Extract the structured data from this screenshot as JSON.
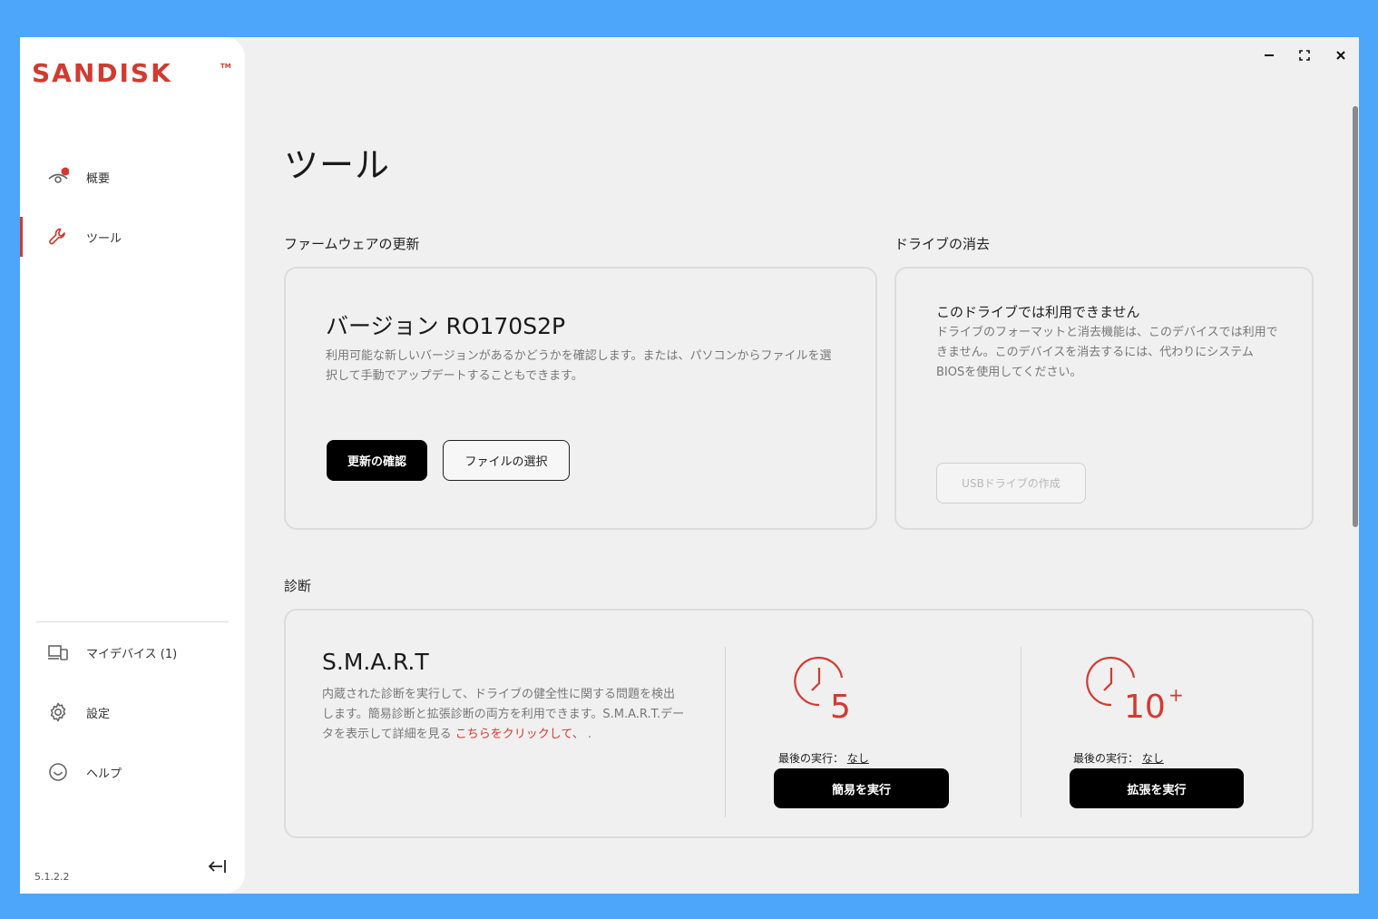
{
  "brand": {
    "logo_text": "SANDISK",
    "tm": "TM",
    "accent": "#d23a30"
  },
  "nav": {
    "overview": "概要",
    "tools": "ツール",
    "my_devices": "マイデバイス (1)",
    "settings": "設定",
    "help": "ヘルプ"
  },
  "app_version": "5.1.2.2",
  "page_title": "ツール",
  "firmware": {
    "section": "ファームウェアの更新",
    "version_label": "バージョン RO170S2P",
    "desc": "利用可能な新しいバージョンがあるかどうかを確認します。または、パソコンからファイルを選択して手動でアップデートすることもできます。",
    "check_button": "更新の確認",
    "select_file_button": "ファイルの選択"
  },
  "erase": {
    "section": "ドライブの消去",
    "title": "このドライブでは利用できません",
    "desc": "ドライブのフォーマットと消去機能は、このデバイスでは利用できません。このデバイスを消去するには、代わりにシステムBIOSを使用してください。",
    "usb_button": "USBドライブの作成"
  },
  "diagnostics": {
    "section": "診断",
    "smart_title": "S.M.A.R.T",
    "desc_prefix": "内蔵された診断を実行して、ドライブの健全性に関する問題を検出します。簡易診断と拡張診断の両方を利用できます。S.M.A.R.T.データを表示して詳細を見る ",
    "desc_link": "こちらをクリックして、",
    "desc_suffix": " .",
    "quick": {
      "minutes": "5",
      "last_run_label": "最後の実行：",
      "last_run_value": "なし",
      "button": "簡易を実行"
    },
    "extended": {
      "minutes": "10",
      "plus": "+",
      "last_run_label": "最後の実行：",
      "last_run_value": "なし",
      "button": "拡張を実行"
    }
  }
}
